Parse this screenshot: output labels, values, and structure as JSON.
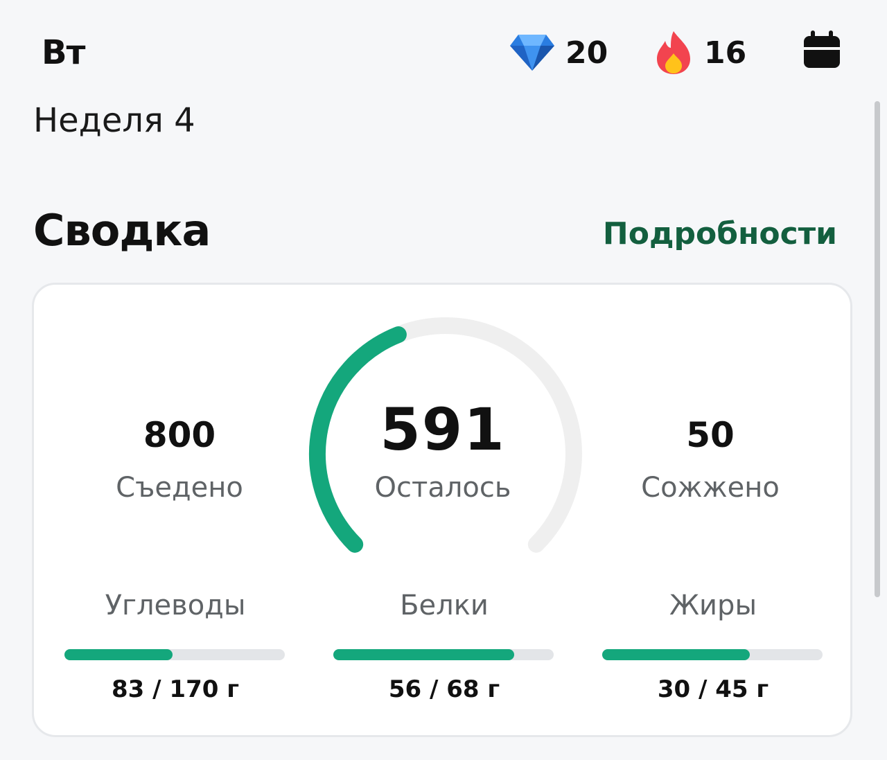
{
  "header": {
    "day": "Вт",
    "gems": {
      "icon": "diamond-icon",
      "value": "20"
    },
    "streak": {
      "icon": "fire-icon",
      "value": "16"
    },
    "calendar_icon": "calendar-icon"
  },
  "week_label": "Неделя 4",
  "summary": {
    "title": "Сводка",
    "details_link": "Подробности",
    "eaten": {
      "value": "800",
      "label": "Съедено"
    },
    "remaining": {
      "value": "591",
      "label": "Осталось",
      "progress": 0.42
    },
    "burned": {
      "value": "50",
      "label": "Сожжено"
    },
    "macros": [
      {
        "name": "Углеводы",
        "amount": "83 / 170 г",
        "progress": 0.49
      },
      {
        "name": "Белки",
        "amount": "56 / 68 г",
        "progress": 0.82
      },
      {
        "name": "Жиры",
        "amount": "30 / 45 г",
        "progress": 0.67
      }
    ]
  },
  "colors": {
    "accent": "#14a77c",
    "link": "#135f3f",
    "track": "#efefef"
  }
}
